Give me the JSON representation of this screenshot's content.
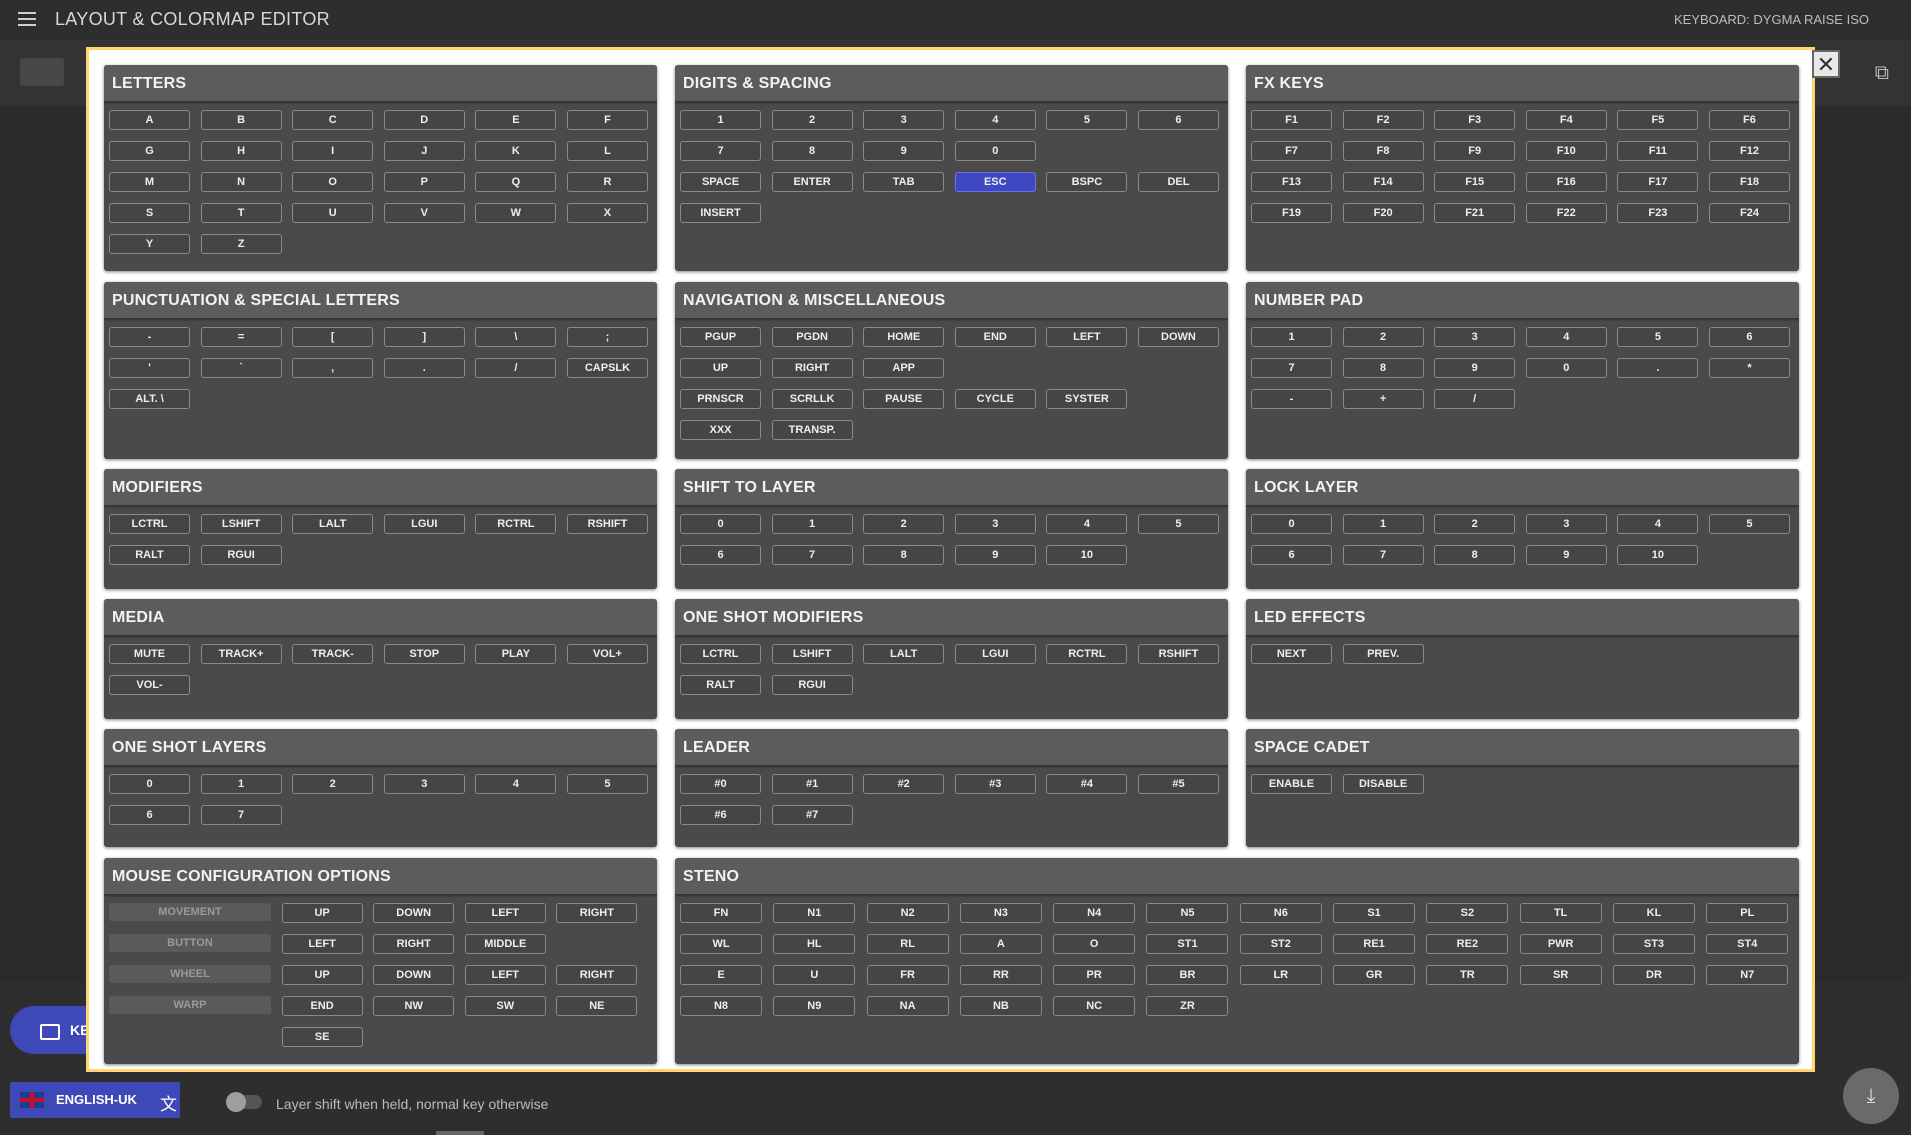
{
  "app": {
    "title": "LAYOUT & COLORMAP EDITOR",
    "keyboard_label": "KEYBOARD: DYGMA RAISE ISO"
  },
  "bottom": {
    "pill_label": "KE",
    "language": "ENGLISH-UK",
    "toggle_label": "Layer shift when held, normal key otherwise"
  },
  "modal": {
    "close": "✕",
    "selected_key": "ESC",
    "sections": {
      "letters": {
        "title": "LETTERS",
        "keys": [
          "A",
          "B",
          "C",
          "D",
          "E",
          "F",
          "G",
          "H",
          "I",
          "J",
          "K",
          "L",
          "M",
          "N",
          "O",
          "P",
          "Q",
          "R",
          "S",
          "T",
          "U",
          "V",
          "W",
          "X",
          "Y",
          "Z"
        ]
      },
      "digits": {
        "title": "DIGITS & SPACING",
        "keys": [
          "1",
          "2",
          "3",
          "4",
          "5",
          "6",
          "7",
          "8",
          "9",
          "0",
          "",
          "",
          "SPACE",
          "ENTER",
          "TAB",
          "ESC",
          "BSPC",
          "DEL",
          "INSERT"
        ]
      },
      "fx": {
        "title": "FX KEYS",
        "keys": [
          "F1",
          "F2",
          "F3",
          "F4",
          "F5",
          "F6",
          "F7",
          "F8",
          "F9",
          "F10",
          "F11",
          "F12",
          "F13",
          "F14",
          "F15",
          "F16",
          "F17",
          "F18",
          "F19",
          "F20",
          "F21",
          "F22",
          "F23",
          "F24"
        ]
      },
      "punct": {
        "title": "PUNCTUATION & SPECIAL LETTERS",
        "keys": [
          "-",
          "=",
          "[",
          "]",
          "\\",
          ";",
          "'",
          "`",
          ",",
          ".",
          "/",
          "CAPSLK",
          "ALT. \\"
        ]
      },
      "nav": {
        "title": "NAVIGATION & MISCELLANEOUS",
        "keys": [
          "PGUP",
          "PGDN",
          "HOME",
          "END",
          "LEFT",
          "DOWN",
          "UP",
          "RIGHT",
          "APP",
          "",
          "",
          "",
          "PRNSCR",
          "SCRLLK",
          "PAUSE",
          "CYCLE",
          "SYSTER",
          "",
          "XXX",
          "TRANSP."
        ]
      },
      "numpad": {
        "title": "NUMBER PAD",
        "keys": [
          "1",
          "2",
          "3",
          "4",
          "5",
          "6",
          "7",
          "8",
          "9",
          "0",
          ".",
          "*",
          "-",
          "+",
          "/"
        ]
      },
      "modifiers": {
        "title": "MODIFIERS",
        "keys": [
          "LCTRL",
          "LSHIFT",
          "LALT",
          "LGUI",
          "RCTRL",
          "RSHIFT",
          "RALT",
          "RGUI"
        ]
      },
      "shift_layer": {
        "title": "SHIFT TO LAYER",
        "keys": [
          "0",
          "1",
          "2",
          "3",
          "4",
          "5",
          "6",
          "7",
          "8",
          "9",
          "10"
        ]
      },
      "lock_layer": {
        "title": "LOCK LAYER",
        "keys": [
          "0",
          "1",
          "2",
          "3",
          "4",
          "5",
          "6",
          "7",
          "8",
          "9",
          "10"
        ]
      },
      "media": {
        "title": "MEDIA",
        "keys": [
          "MUTE",
          "TRACK+",
          "TRACK-",
          "STOP",
          "PLAY",
          "VOL+",
          "VOL-"
        ]
      },
      "oneshot_mod": {
        "title": "ONE SHOT MODIFIERS",
        "keys": [
          "LCTRL",
          "LSHIFT",
          "LALT",
          "LGUI",
          "RCTRL",
          "RSHIFT",
          "RALT",
          "RGUI"
        ]
      },
      "led": {
        "title": "LED EFFECTS",
        "keys": [
          "NEXT",
          "PREV."
        ]
      },
      "oneshot_layers": {
        "title": "ONE SHOT LAYERS",
        "keys": [
          "0",
          "1",
          "2",
          "3",
          "4",
          "5",
          "6",
          "7"
        ]
      },
      "leader": {
        "title": "LEADER",
        "keys": [
          "#0",
          "#1",
          "#2",
          "#3",
          "#4",
          "#5",
          "#6",
          "#7"
        ]
      },
      "space_cadet": {
        "title": "SPACE CADET",
        "keys": [
          "ENABLE",
          "DISABLE"
        ]
      },
      "mouse": {
        "title": "MOUSE CONFIGURATION OPTIONS",
        "rows": [
          {
            "label": "MOVEMENT",
            "keys": [
              "UP",
              "DOWN",
              "LEFT",
              "RIGHT"
            ]
          },
          {
            "label": "BUTTON",
            "keys": [
              "LEFT",
              "RIGHT",
              "MIDDLE"
            ]
          },
          {
            "label": "WHEEL",
            "keys": [
              "UP",
              "DOWN",
              "LEFT",
              "RIGHT"
            ]
          },
          {
            "label": "WARP",
            "keys": [
              "END",
              "NW",
              "SW",
              "NE"
            ]
          },
          {
            "label": "",
            "keys": [
              "SE"
            ]
          }
        ]
      },
      "steno": {
        "title": "STENO",
        "keys": [
          "FN",
          "N1",
          "N2",
          "N3",
          "N4",
          "N5",
          "N6",
          "S1",
          "S2",
          "TL",
          "KL",
          "PL",
          "WL",
          "HL",
          "RL",
          "A",
          "O",
          "ST1",
          "ST2",
          "RE1",
          "RE2",
          "PWR",
          "ST3",
          "ST4",
          "E",
          "U",
          "FR",
          "RR",
          "PR",
          "BR",
          "LR",
          "GR",
          "TR",
          "SR",
          "DR",
          "N7",
          "N8",
          "N9",
          "NA",
          "NB",
          "NC",
          "ZR"
        ]
      }
    }
  },
  "colors": {
    "accent": "#3f47c2",
    "modal_border": "#ffd66e",
    "panel": "#4a4a4a",
    "panel_header": "#5c5c5c"
  }
}
